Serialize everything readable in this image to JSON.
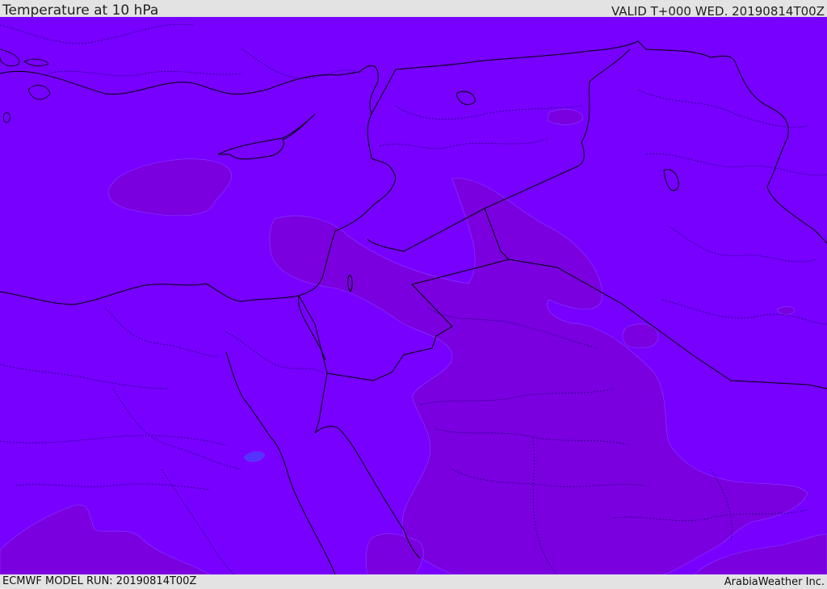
{
  "header": {
    "title": "Temperature at 10 hPa",
    "valid": "VALID T+000 WED. 20190814T00Z"
  },
  "footer": {
    "model_run": "ECMWF MODEL RUN: 20190814T00Z",
    "credit": "ArabiaWeather Inc."
  },
  "map": {
    "colors": {
      "base_field": "#7700ff",
      "cooler_field": "#7a00e0",
      "small_blob": "#5533ff",
      "borders": "#000000"
    }
  }
}
